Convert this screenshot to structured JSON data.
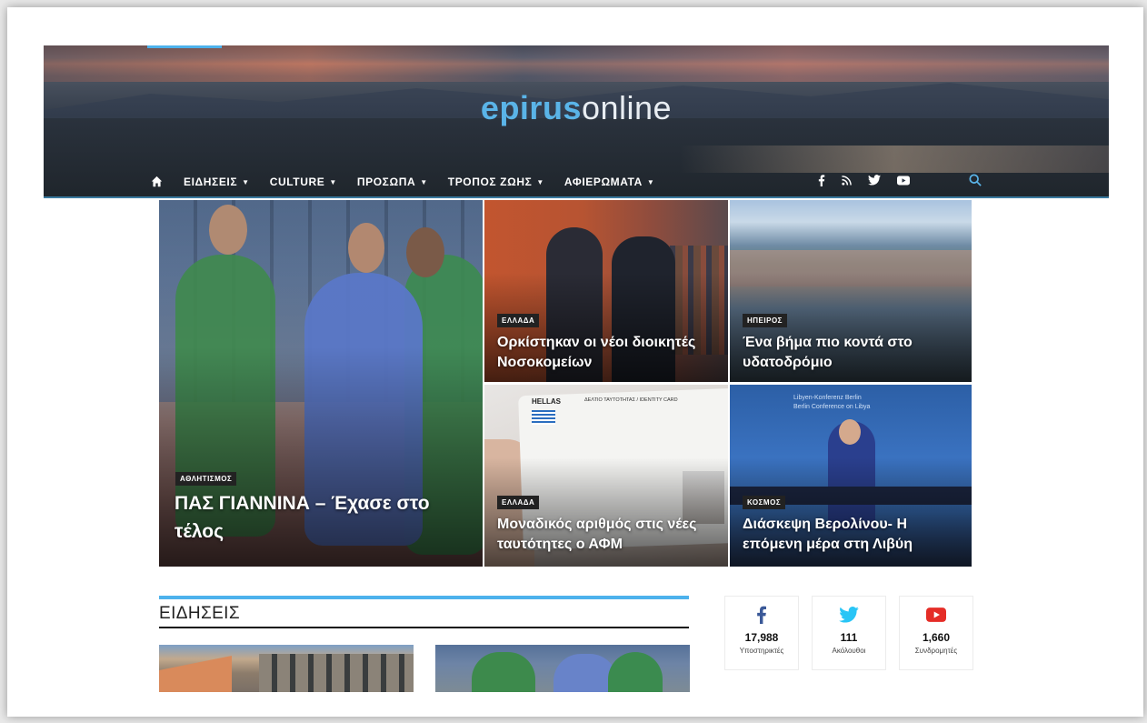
{
  "site": {
    "logo_bold": "epirus",
    "logo_light": "online"
  },
  "nav": {
    "items": [
      {
        "label": "ΕΙΔΗΣΕΙΣ"
      },
      {
        "label": "CULTURE"
      },
      {
        "label": "ΠΡΟΣΩΠΑ"
      },
      {
        "label": "ΤΡΟΠΟΣ ΖΩΗΣ"
      },
      {
        "label": "ΑΦΙΕΡΩΜΑΤΑ"
      }
    ],
    "social_icons": [
      "facebook-icon",
      "rss-icon",
      "twitter-icon",
      "youtube-icon"
    ],
    "search_icon": "search-icon",
    "home_icon": "home-icon"
  },
  "featured": [
    {
      "category": "ΑΘΛΗΤΙΣΜΟΣ",
      "title": "ΠΑΣ ΓΙΑΝΝΙΝΑ – Έχασε στο τέλος"
    },
    {
      "category": "ΕΛΛΑΔΑ",
      "title": "Ορκίστηκαν οι νέοι διοικητές Νοσοκομείων"
    },
    {
      "category": "ΗΠΕΙΡΟΣ",
      "title": "Ένα βήμα πιο κοντά στο υδατοδρόμιο"
    },
    {
      "category": "ΕΛΛΑΔΑ",
      "title": "Μοναδικός αριθμός στις νέες ταυτότητες ο ΑΦΜ"
    },
    {
      "category": "ΚΟΣΜΟΣ",
      "title": "Διάσκεψη Βερολίνου- Η επόμενη μέρα στη Λιβύη"
    }
  ],
  "image_text": {
    "id_card_country": "HELLAS",
    "id_card_title": "ΔΕΛΤΙΟ ΤΑΥΤΟΤΗΤΑΣ / IDENTITY CARD",
    "conference_line1": "Libyen-Konferenz Berlin",
    "conference_line2": "Berlin Conference on Libya"
  },
  "news_section": {
    "title": "ΕΙΔΗΣΕΙΣ"
  },
  "social_counters": [
    {
      "icon": "facebook-icon",
      "count": "17,988",
      "label": "Υποστηρικτές",
      "color": "#3b5998"
    },
    {
      "icon": "twitter-icon",
      "count": "111",
      "label": "Ακόλουθοι",
      "color": "#29c5f6"
    },
    {
      "icon": "youtube-icon",
      "count": "1,660",
      "label": "Συνδρομητές",
      "color": "#e52d27"
    }
  ],
  "colors": {
    "accent": "#4db2ec"
  }
}
